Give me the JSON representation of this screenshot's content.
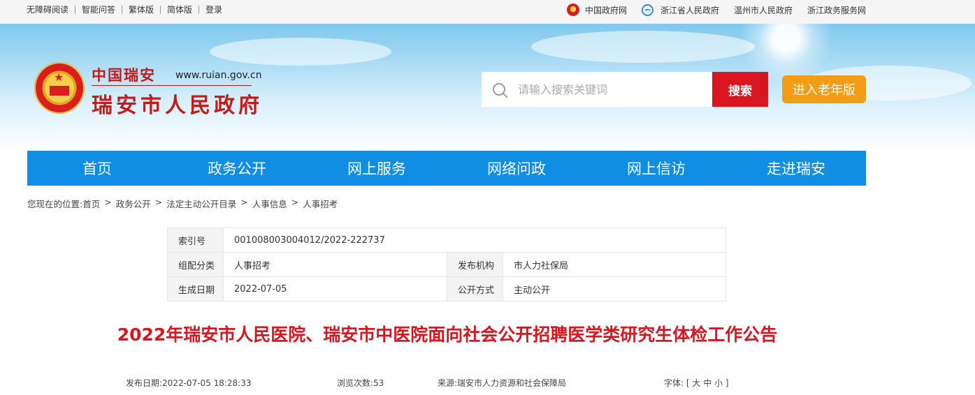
{
  "topbar": {
    "left_items": [
      "无障碍阅读",
      "智能问答",
      "繁体版",
      "简体版",
      "登录"
    ],
    "right_links": [
      "中国政府网",
      "浙江省人民政府",
      "温州市人民政府",
      "浙江政务服务网"
    ]
  },
  "header": {
    "brand_small": "中国瑞安",
    "site_url": "www.ruian.gov.cn",
    "brand_big": "瑞安市人民政府",
    "search_placeholder": "请输入搜索关键词",
    "search_button": "搜索",
    "elder_button": "进入老年版"
  },
  "nav": [
    "首页",
    "政务公开",
    "网上服务",
    "网络问政",
    "网上信访",
    "走进瑞安"
  ],
  "breadcrumb": {
    "prefix": "您现在的位置:",
    "items": [
      "首页",
      "政务公开",
      "法定主动公开目录",
      "人事信息",
      "人事招考"
    ],
    "separator": ">"
  },
  "info": {
    "index_label": "索引号",
    "index_value": "001008003004012/2022-222737",
    "category_label": "组配分类",
    "category_value": "人事招考",
    "publisher_label": "发布机构",
    "publisher_value": "市人力社保局",
    "date_label": "生成日期",
    "date_value": "2022-07-05",
    "mode_label": "公开方式",
    "mode_value": "主动公开"
  },
  "article": {
    "title": "2022年瑞安市人民医院、瑞安市中医院面向社会公开招聘医学类研究生体检工作公告",
    "publish_label": "发布日期:",
    "publish_value": "2022-07-05 18:28:33",
    "views_label": "浏览次数:",
    "views_value": "53",
    "source_label": "来源:",
    "source_value": "瑞安市人力资源和社会保障局",
    "font_label": "字体:",
    "font_open": "[",
    "font_large": "大",
    "font_medium": "中",
    "font_small": "小",
    "font_close": "]"
  },
  "colors": {
    "nav_blue": "#0f8ee4",
    "brand_red": "#d9161f",
    "elder_orange": "#f39c16"
  }
}
